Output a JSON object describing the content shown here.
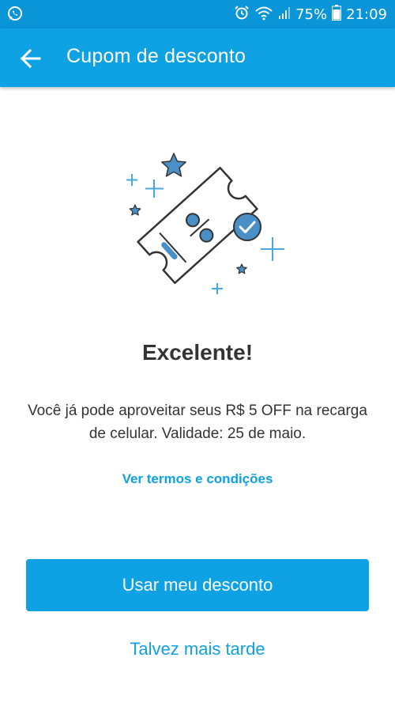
{
  "status_bar": {
    "battery": "75%",
    "time": "21:09",
    "icons": [
      "whatsapp-icon",
      "alarm-icon",
      "wifi-icon",
      "signal-icon",
      "battery-icon"
    ]
  },
  "app_bar": {
    "title": "Cupom de desconto",
    "back_icon": "arrow-left-icon"
  },
  "content": {
    "headline": "Excelente!",
    "body": "Você já pode aproveitar seus R$ 5 OFF na recarga de celular. Validade: 25 de maio.",
    "terms_link": "Ver termos e condições"
  },
  "actions": {
    "primary": "Usar meu desconto",
    "secondary": "Talvez mais tarde"
  },
  "colors": {
    "brand": "#0ea1e3",
    "status_bar": "#0a95d9",
    "text": "#333333",
    "star": "#4a90c8"
  }
}
